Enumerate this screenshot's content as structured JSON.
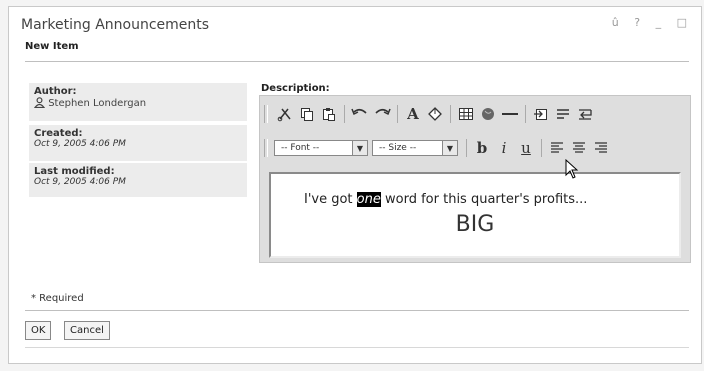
{
  "portlet": {
    "title": "Marketing Announcements",
    "controls": "û ? _ □"
  },
  "form": {
    "subtitle": "New Item"
  },
  "meta": {
    "author_label": "Author:",
    "author_name": "Stephen Londergan",
    "created_label": "Created:",
    "created_value": "Oct 9, 2005 4:06 PM",
    "modified_label": "Last modified:",
    "modified_value": "Oct 9, 2005 4:06 PM"
  },
  "editor": {
    "label": "Description:",
    "font_select": "-- Font --",
    "size_select": "-- Size --",
    "bold": "b",
    "italic": "i",
    "underline": "u",
    "text_before": "I've got ",
    "text_highlight": "one",
    "text_after": " word for this quarter's profits...",
    "big_text": "BIG"
  },
  "footer": {
    "required": "* Required",
    "ok": "OK",
    "cancel": "Cancel"
  }
}
